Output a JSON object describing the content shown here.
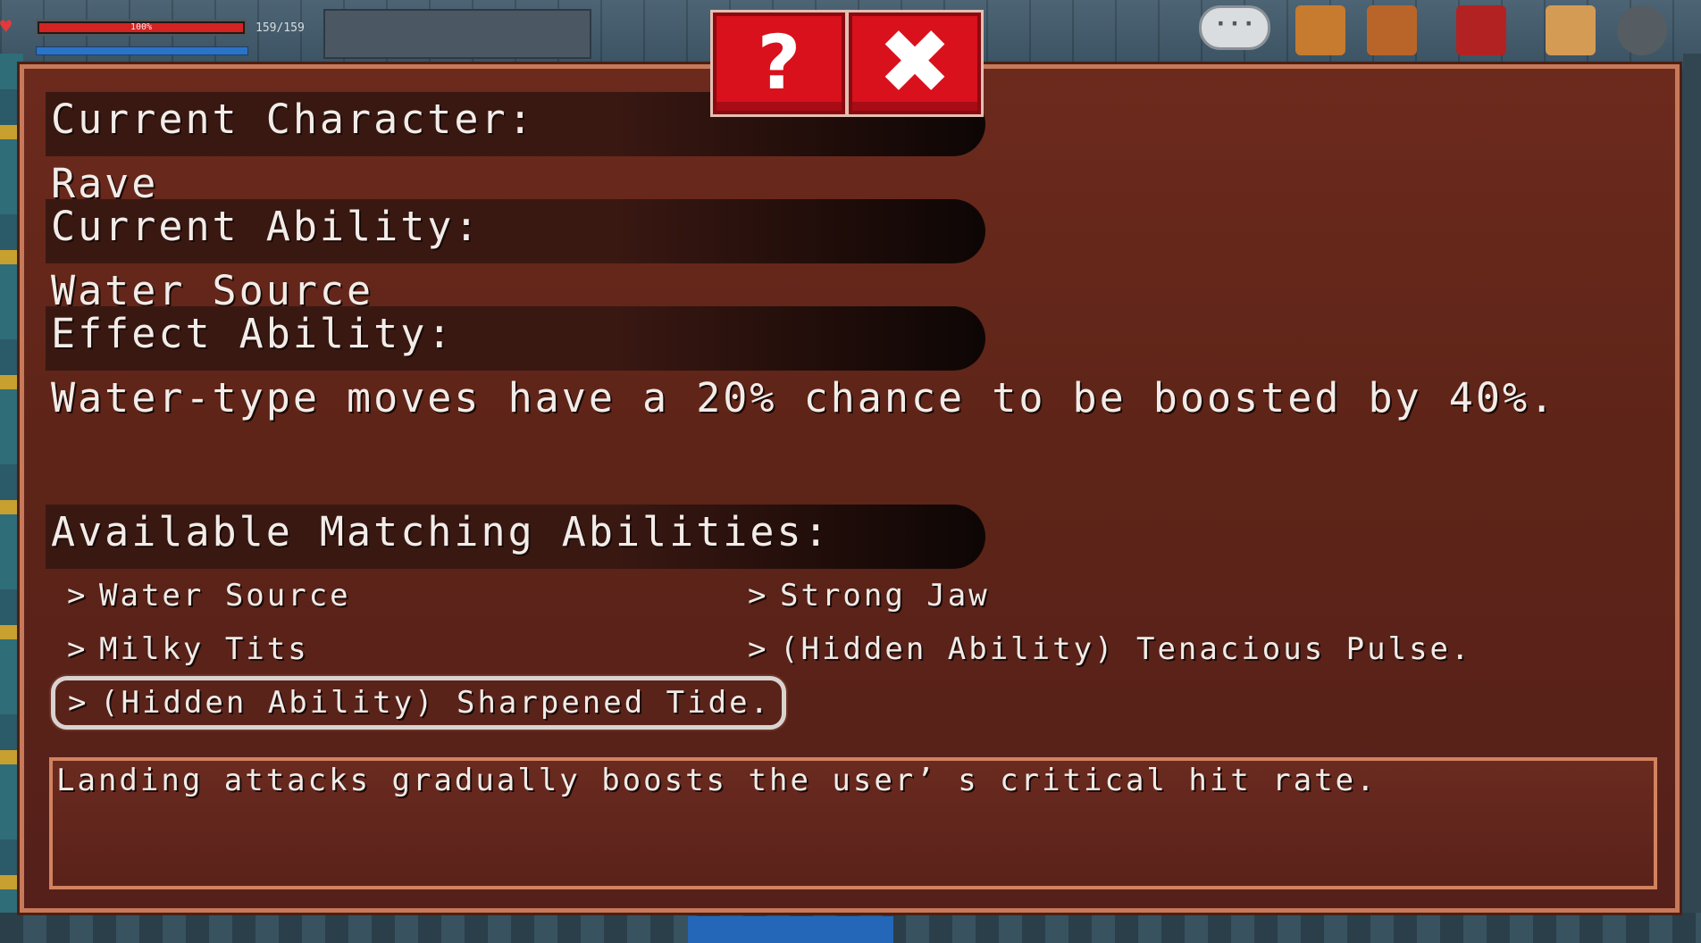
{
  "hud": {
    "health_percent_label": "100%",
    "hp_value": "159/159"
  },
  "modal": {
    "current_character_label": "Current Character:",
    "current_character_value": "Rave",
    "current_ability_label": "Current Ability:",
    "current_ability_value": "Water Source",
    "effect_label": "Effect Ability:",
    "effect_text": "Water-type moves have a 20% chance to be boosted by 40%.",
    "available_label": "Available Matching Abilities:",
    "abilities": [
      {
        "label": "Water Source"
      },
      {
        "label": "Strong Jaw"
      },
      {
        "label": "Milky Tits"
      },
      {
        "label": "(Hidden Ability) Tenacious Pulse."
      },
      {
        "label": "(Hidden Ability) Sharpened Tide."
      }
    ],
    "selected_description": "Landing attacks gradually boosts the user’ s critical hit rate.",
    "chevron": ">",
    "help_label": "?",
    "close_label": "✖"
  },
  "colors": {
    "panel_bg": "#5e2418",
    "panel_border": "#c8795a",
    "button_red": "#d8111c",
    "text": "#f2ece8"
  }
}
